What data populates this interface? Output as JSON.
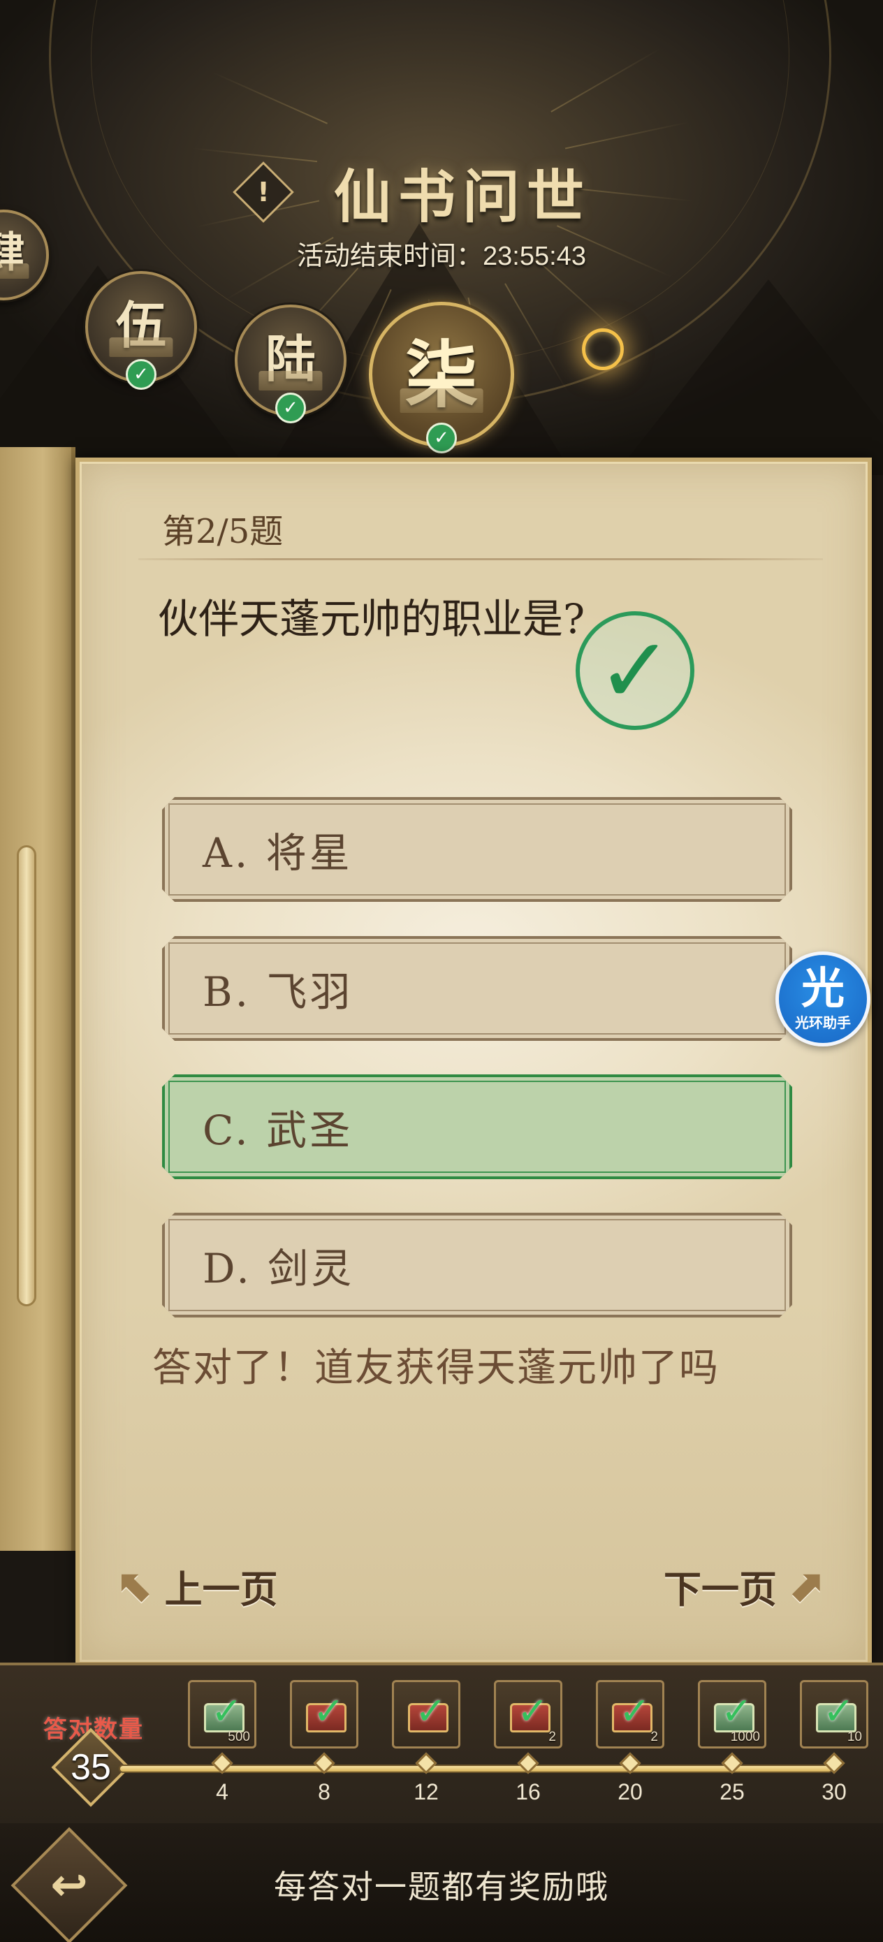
{
  "header": {
    "title": "仙书问世",
    "end_time_label": "活动结束时间：23:55:43",
    "info_icon": "!"
  },
  "chapters": [
    {
      "label": "肆",
      "completed": true,
      "active": false
    },
    {
      "label": "伍",
      "completed": true,
      "active": false
    },
    {
      "label": "陆",
      "completed": true,
      "active": false
    },
    {
      "label": "柒",
      "completed": true,
      "active": true
    }
  ],
  "question": {
    "number_label": "第2/5题",
    "text": "伙伴天蓬元帅的职业是?",
    "options": [
      {
        "label": "A. 将星",
        "state": "normal"
      },
      {
        "label": "B. 飞羽",
        "state": "normal"
      },
      {
        "label": "C. 武圣",
        "state": "correct"
      },
      {
        "label": "D. 剑灵",
        "state": "normal"
      }
    ],
    "feedback": "答对了！道友获得天蓬元帅了吗"
  },
  "navigation": {
    "prev_label": "上一页",
    "next_label": "下一页"
  },
  "assistant": {
    "icon_text": "光",
    "label": "光环助手"
  },
  "rewards": {
    "count_label": "答对数量",
    "correct_count": "35",
    "progress_fraction": 1.0,
    "milestones": [
      {
        "threshold": "4",
        "reward": "jade",
        "qty": "500",
        "claimed": true
      },
      {
        "threshold": "8",
        "reward": "chest",
        "qty": "",
        "claimed": true
      },
      {
        "threshold": "12",
        "reward": "chest",
        "qty": "",
        "claimed": true
      },
      {
        "threshold": "16",
        "reward": "chest",
        "qty": "2",
        "claimed": true
      },
      {
        "threshold": "20",
        "reward": "chest",
        "qty": "2",
        "claimed": true
      },
      {
        "threshold": "25",
        "reward": "jade",
        "qty": "1000",
        "claimed": true
      },
      {
        "threshold": "30",
        "reward": "jade",
        "qty": "10",
        "claimed": true
      }
    ]
  },
  "footer": {
    "tip": "每答对一题都有奖励哦",
    "back_icon": "back-arrow-icon"
  },
  "colors": {
    "correct_green": "#2f8a42",
    "accent_gold": "#d7b564",
    "count_label_red": "#e85a4a"
  }
}
